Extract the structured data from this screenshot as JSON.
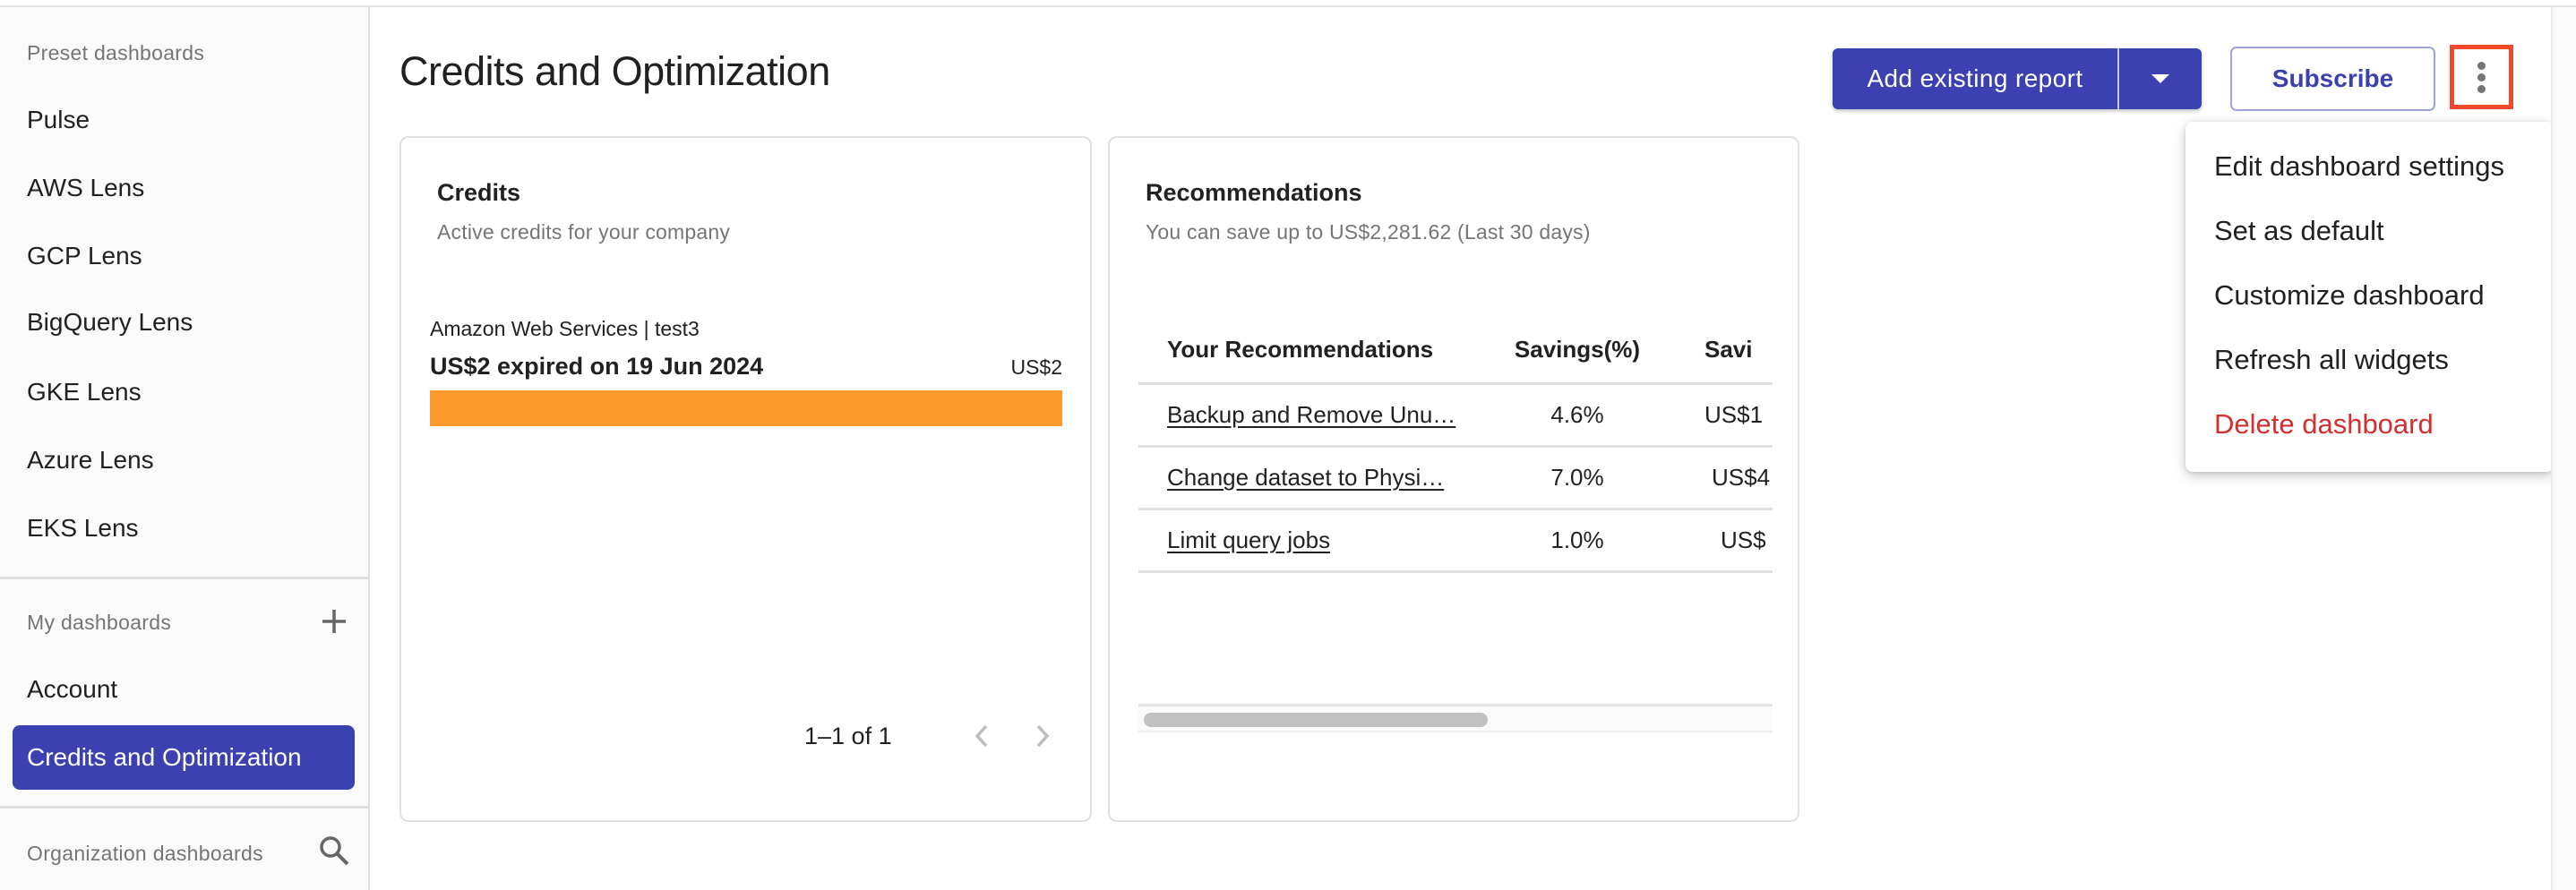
{
  "sidebar": {
    "preset_title": "Preset dashboards",
    "preset_items": [
      "Pulse",
      "AWS Lens",
      "GCP Lens",
      "BigQuery Lens",
      "GKE Lens",
      "Azure Lens",
      "EKS Lens"
    ],
    "my_title": "My dashboards",
    "my_items": [
      "Account",
      "Credits and Optimization"
    ],
    "active_item": "Credits and Optimization",
    "org_title": "Organization dashboards",
    "icons": {
      "add": "plus-icon",
      "search": "search-icon"
    }
  },
  "header": {
    "title": "Credits and Optimization",
    "add_report_label": "Add existing report",
    "subscribe_label": "Subscribe",
    "more_icon": "more-vert-icon"
  },
  "menu": {
    "items": [
      {
        "label": "Edit dashboard settings",
        "danger": false
      },
      {
        "label": "Set as default",
        "danger": false
      },
      {
        "label": "Customize dashboard",
        "danger": false
      },
      {
        "label": "Refresh all widgets",
        "danger": false
      },
      {
        "label": "Delete dashboard",
        "danger": true
      }
    ]
  },
  "credits": {
    "title": "Credits",
    "subtitle": "Active credits for your company",
    "entry": {
      "provider": "Amazon Web Services | test3",
      "summary": "US$2 expired on 19 Jun 2024",
      "amount": "US$2",
      "used_fraction": 1.0,
      "bar_color": "#fe9a2e"
    },
    "pagination": "1–1 of 1"
  },
  "recommendations": {
    "title": "Recommendations",
    "subtitle": "You can save up to US$2,281.62 (Last 30 days)",
    "columns": [
      "Your Recommendations",
      "Savings(%)",
      "Savi"
    ],
    "rows": [
      {
        "name": "Backup and Remove Unu…",
        "pct": "4.6%",
        "savings": "US$1"
      },
      {
        "name": "Change dataset to Physi…",
        "pct": "7.0%",
        "savings": "US$4"
      },
      {
        "name": "Limit query jobs",
        "pct": "1.0%",
        "savings": "US$"
      }
    ]
  },
  "colors": {
    "primary": "#3b41b1",
    "danger": "#d32f2f",
    "highlight": "#f04a2b"
  }
}
